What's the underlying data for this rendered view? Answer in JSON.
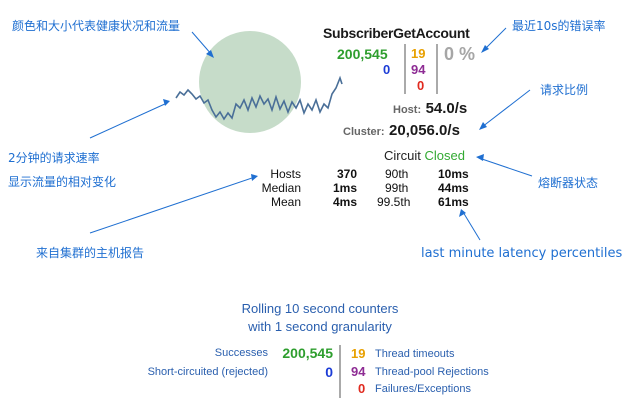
{
  "colors": {
    "annotation": "#1f6fd1",
    "success": "#2e9e2e",
    "timeout": "#e8a000",
    "rejection": "#8e2c94",
    "failure": "#e02a1f",
    "short_circuited": "#1c3cd6",
    "error_pct": "#a6a6a6",
    "closed": "#33aa33",
    "circle": "#c6dcc9",
    "sparkline": "#4a6f98"
  },
  "circuit": {
    "name": "SubscriberGetAccount",
    "success": "200,545",
    "short_circuited": "0",
    "timeout": "19",
    "rejection": "94",
    "failure": "0",
    "error_pct": "0 %",
    "host_label": "Host:",
    "host_rate": "54.0/s",
    "cluster_label": "Cluster:",
    "cluster_rate": "20,056.0/s",
    "circuit_label": "Circuit",
    "circuit_state": "Closed"
  },
  "stats": {
    "rows": [
      {
        "label": "Hosts",
        "value": "370",
        "pct": "90th",
        "latency": "10ms"
      },
      {
        "label": "Median",
        "value": "1ms",
        "pct": "99th",
        "latency": "44ms"
      },
      {
        "label": "Mean",
        "value": "4ms",
        "pct": "99.5th",
        "latency": "61ms"
      }
    ]
  },
  "annotations": {
    "color_size": "颜色和大小代表健康状况和流量",
    "error_rate": "最近10s的错误率",
    "request_ratio": "请求比例",
    "request_rate": "2分钟的请求速率",
    "traffic_change": "显示流量的相对变化",
    "breaker_state": "熔断器状态",
    "host_report": "来自集群的主机报告",
    "latency_percentiles": "last minute latency percentiles"
  },
  "legend": {
    "title_line1": "Rolling 10 second counters",
    "title_line2": "with 1 second granularity",
    "successes_label": "Successes",
    "successes_value": "200,545",
    "short_label": "Short-circuited (rejected)",
    "short_value": "0",
    "timeouts_value": "19",
    "timeouts_label": "Thread timeouts",
    "rejections_value": "94",
    "rejections_label": "Thread-pool Rejections",
    "failures_value": "0",
    "failures_label": "Failures/Exceptions"
  }
}
